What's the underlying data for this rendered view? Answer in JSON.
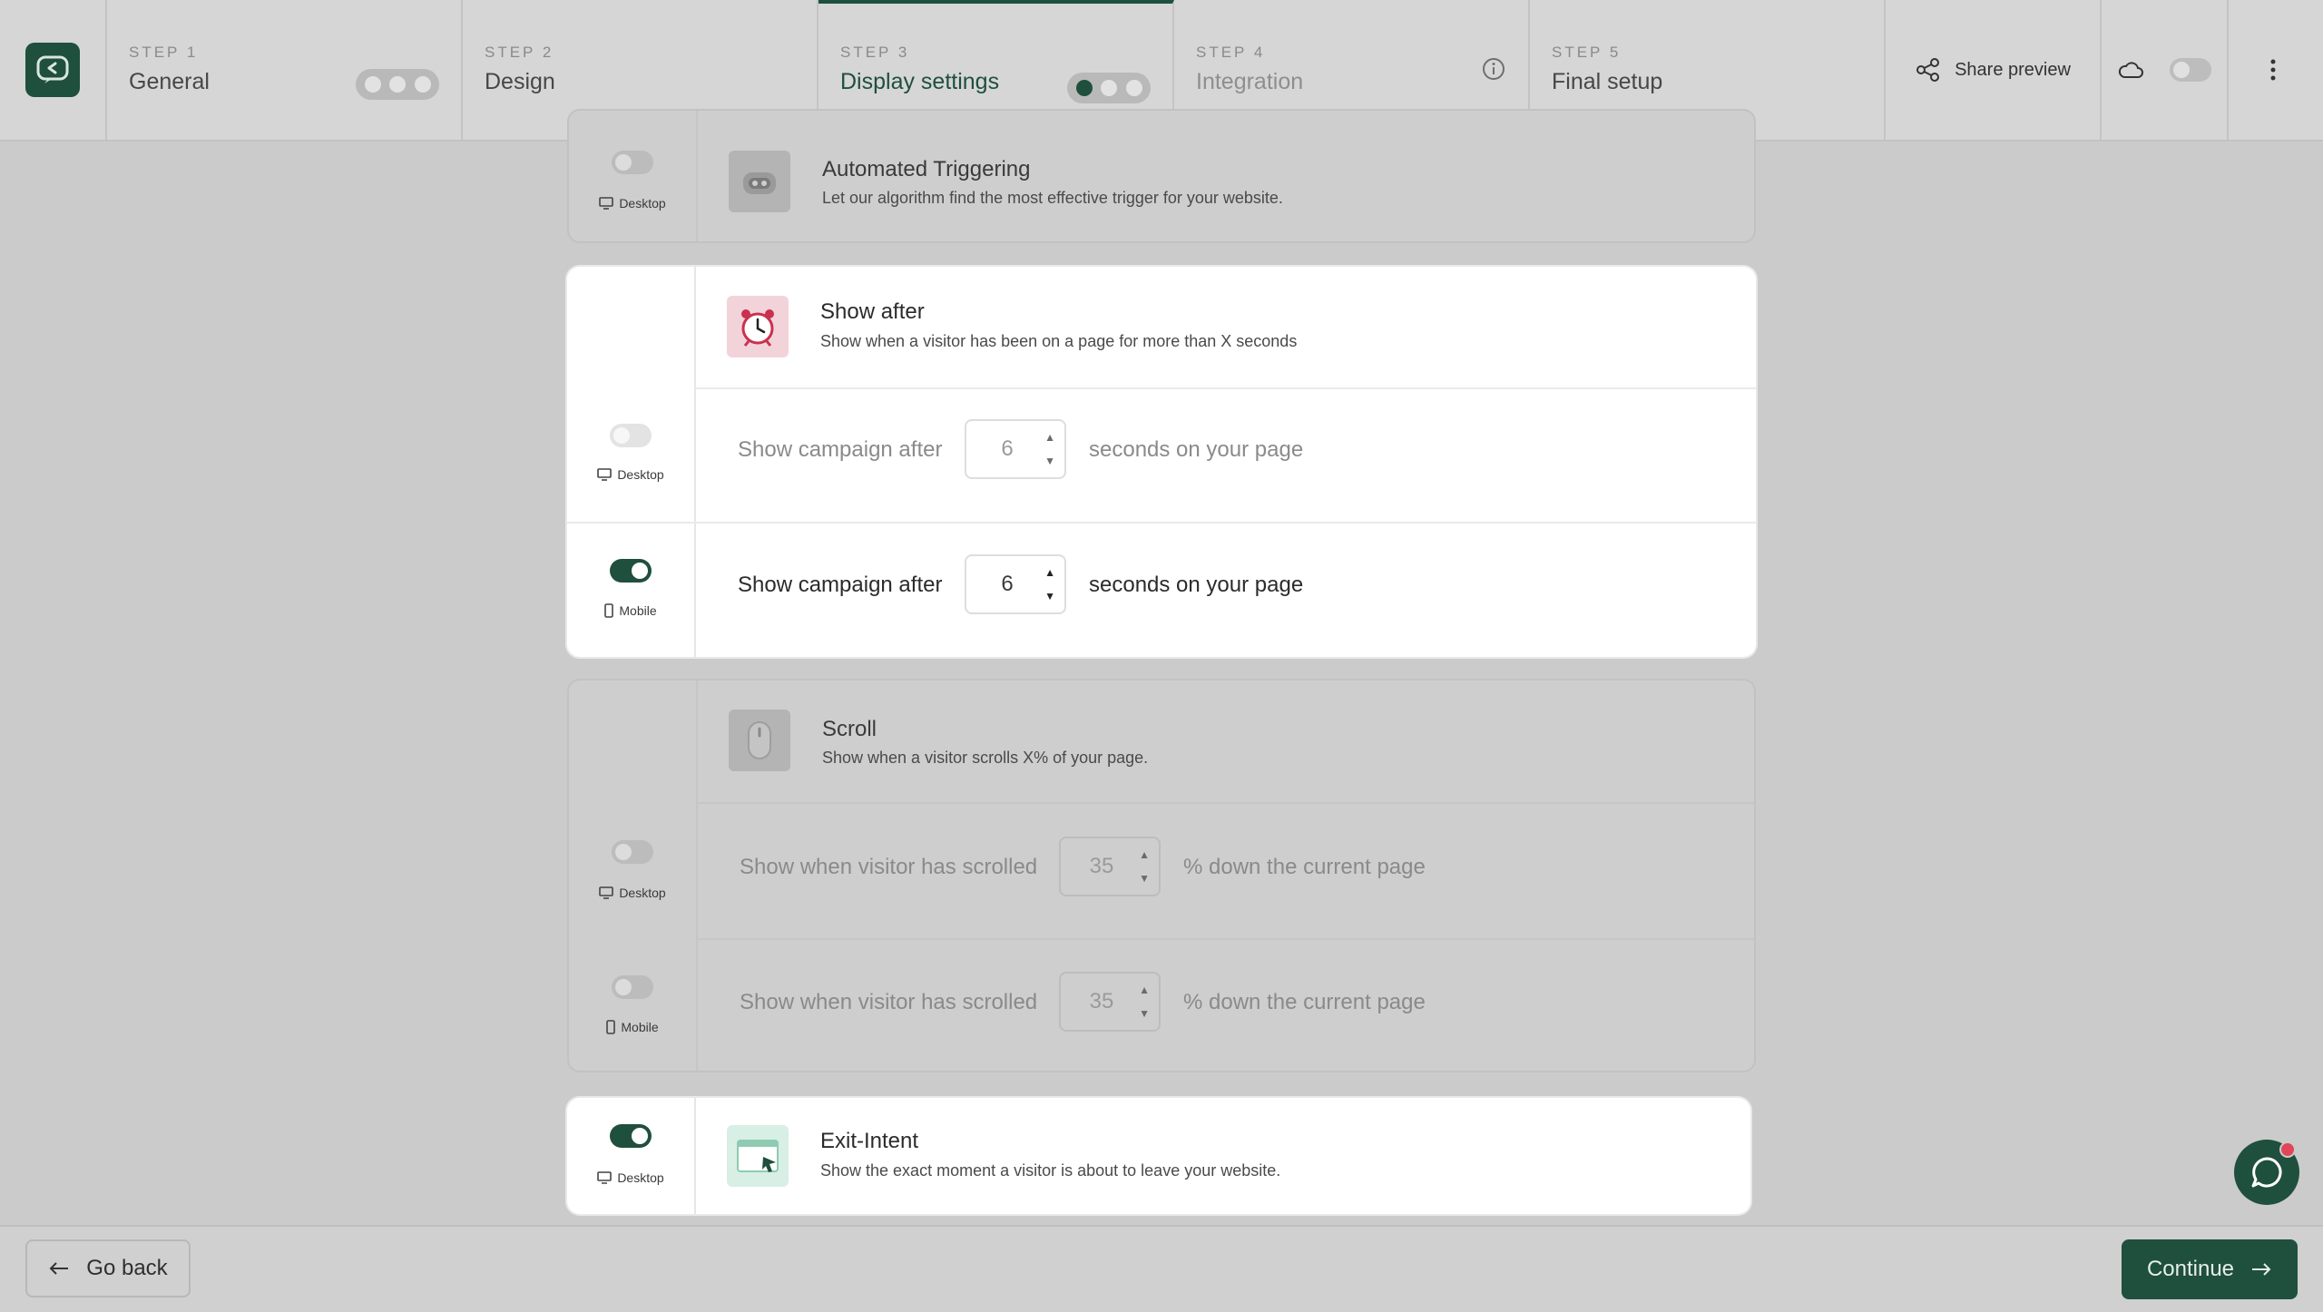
{
  "colors": {
    "brand": "#1f4f3d",
    "overlay": "#cbcbcb",
    "badge": "#e0455a"
  },
  "header": {
    "steps": [
      {
        "num": "STEP 1",
        "title": "General"
      },
      {
        "num": "STEP 2",
        "title": "Design"
      },
      {
        "num": "STEP 3",
        "title": "Display settings"
      },
      {
        "num": "STEP 4",
        "title": "Integration"
      },
      {
        "num": "STEP 5",
        "title": "Final setup"
      }
    ],
    "share_label": "Share preview"
  },
  "devices": {
    "desktop": "Desktop",
    "mobile": "Mobile"
  },
  "automated": {
    "title": "Automated Triggering",
    "desc": "Let our algorithm find the most effective trigger for your website."
  },
  "show_after": {
    "title": "Show after",
    "desc": "Show when a visitor has been on a page for more than X seconds",
    "prefix": "Show campaign after",
    "suffix": "seconds on your page",
    "desktop_value": "6",
    "mobile_value": "6"
  },
  "scroll": {
    "title": "Scroll",
    "desc": "Show when a visitor scrolls X% of your page.",
    "prefix": "Show when visitor has scrolled",
    "suffix": "% down the current page",
    "desktop_value": "35",
    "mobile_value": "35"
  },
  "exit_intent": {
    "title": "Exit-Intent",
    "desc": "Show the exact moment a visitor is about to leave your website."
  },
  "footer": {
    "back_label": "Go back",
    "continue_label": "Continue"
  }
}
